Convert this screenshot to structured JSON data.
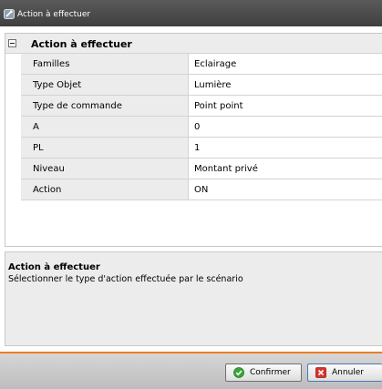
{
  "window": {
    "title": "Action à effectuer"
  },
  "grid": {
    "category": "Action à effectuer",
    "rows": [
      {
        "name": "Familles",
        "value": "Eclairage"
      },
      {
        "name": "Type Objet",
        "value": "Lumière"
      },
      {
        "name": "Type de commande",
        "value": "Point point"
      },
      {
        "name": "A",
        "value": "0"
      },
      {
        "name": "PL",
        "value": "1"
      },
      {
        "name": "Niveau",
        "value": "Montant privé"
      },
      {
        "name": "Action",
        "value": "ON"
      }
    ]
  },
  "description": {
    "title": "Action à effectuer",
    "text": "Sélectionner le type d'action effectuée par le scénario"
  },
  "footer": {
    "confirm_label": "Confirmer",
    "cancel_label": "Annuler"
  },
  "colors": {
    "accent": "#ef7d22",
    "titlebar": "#4a4a4a",
    "confirm_icon": "#3aa53a",
    "cancel_icon": "#d9322b"
  },
  "icons": {
    "app": "wrench-icon",
    "collapse": "minus-box-icon",
    "confirm": "check-circle-icon",
    "cancel": "close-box-icon"
  }
}
